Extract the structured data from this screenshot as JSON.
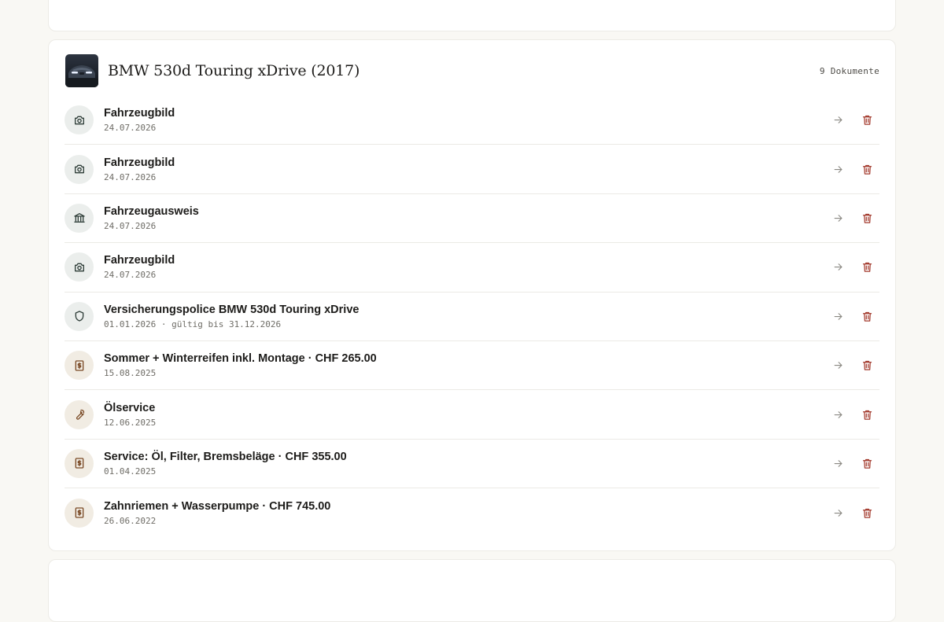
{
  "vehicle": {
    "title": "BMW 530d Touring xDrive (2017)",
    "doc_count": "9 Dokumente"
  },
  "documents": [
    {
      "icon": "camera-icon",
      "tone": "cool",
      "title": "Fahrzeugbild",
      "subtitle": "24.07.2026"
    },
    {
      "icon": "camera-icon",
      "tone": "cool",
      "title": "Fahrzeugbild",
      "subtitle": "24.07.2026"
    },
    {
      "icon": "bank-icon",
      "tone": "cool",
      "title": "Fahrzeugausweis",
      "subtitle": "24.07.2026"
    },
    {
      "icon": "camera-icon",
      "tone": "cool",
      "title": "Fahrzeugbild",
      "subtitle": "24.07.2026"
    },
    {
      "icon": "shield-icon",
      "tone": "cool",
      "title": "Versicherungspolice BMW 530d Touring xDrive",
      "subtitle": "01.01.2026 · gültig bis 31.12.2026"
    },
    {
      "icon": "receipt-dollar-icon",
      "tone": "warm",
      "title": "Sommer + Winterreifen inkl. Montage · CHF 265.00",
      "subtitle": "15.08.2025"
    },
    {
      "icon": "wrench-icon",
      "tone": "warm",
      "title": "Ölservice",
      "subtitle": "12.06.2025"
    },
    {
      "icon": "receipt-dollar-icon",
      "tone": "warm",
      "title": "Service: Öl, Filter, Bremsbeläge · CHF 355.00",
      "subtitle": "01.04.2025"
    },
    {
      "icon": "receipt-dollar-icon",
      "tone": "warm",
      "title": "Zahnriemen + Wasserpumpe · CHF 745.00",
      "subtitle": "26.06.2022"
    }
  ],
  "colors": {
    "delete": "#a33a2d",
    "arrow": "#8a8882",
    "icon_bg_cool": "#ebeeec",
    "icon_bg_warm": "#f1ece3"
  }
}
